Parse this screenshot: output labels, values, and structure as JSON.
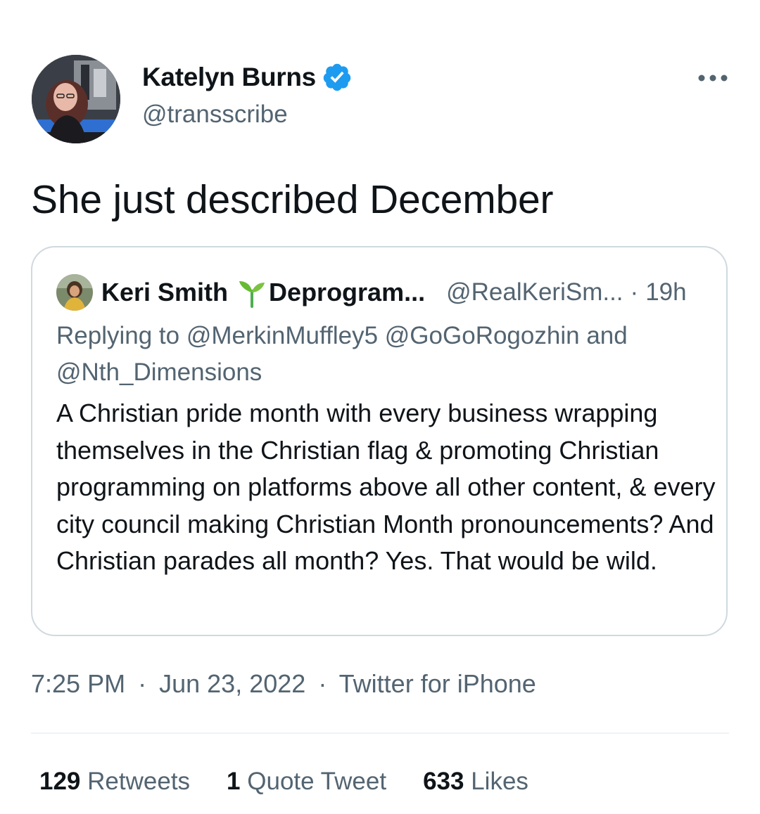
{
  "author": {
    "display_name": "Katelyn Burns",
    "handle": "@transscribe",
    "avatar_icon": "profile-photo",
    "verified_icon": "verified-badge-icon",
    "verified_color": "#1d9bf0"
  },
  "tweet": {
    "text": "She just described December"
  },
  "quoted": {
    "name": "Keri Smith",
    "name_suffix": "Deprogram...",
    "sprout_icon": "seedling-icon",
    "handle": "@RealKeriSm...",
    "separator": "·",
    "time": "19h",
    "replying_prefix": "Replying to",
    "replying_to": [
      "@MerkinMuffley5",
      "@GoGoRogozhin",
      "@Nth_Dimensions"
    ],
    "replying_and": "and",
    "body": "A Christian pride month with every business wrapping themselves in the Christian flag & promoting Christian programming on platforms above all other content, & every city council making Christian Month pronouncements? And Christian parades all month? Yes. That would be wild."
  },
  "meta": {
    "time": "7:25 PM",
    "date": "Jun 23, 2022",
    "source": "Twitter for iPhone",
    "separator": "·"
  },
  "stats": {
    "retweets_count": "129",
    "retweets_label": "Retweets",
    "quotes_count": "1",
    "quotes_label": "Quote Tweet",
    "likes_count": "633",
    "likes_label": "Likes"
  },
  "colors": {
    "text": "#0f1419",
    "secondary": "#536471",
    "border": "#cfd9de",
    "accent": "#1d9bf0"
  }
}
